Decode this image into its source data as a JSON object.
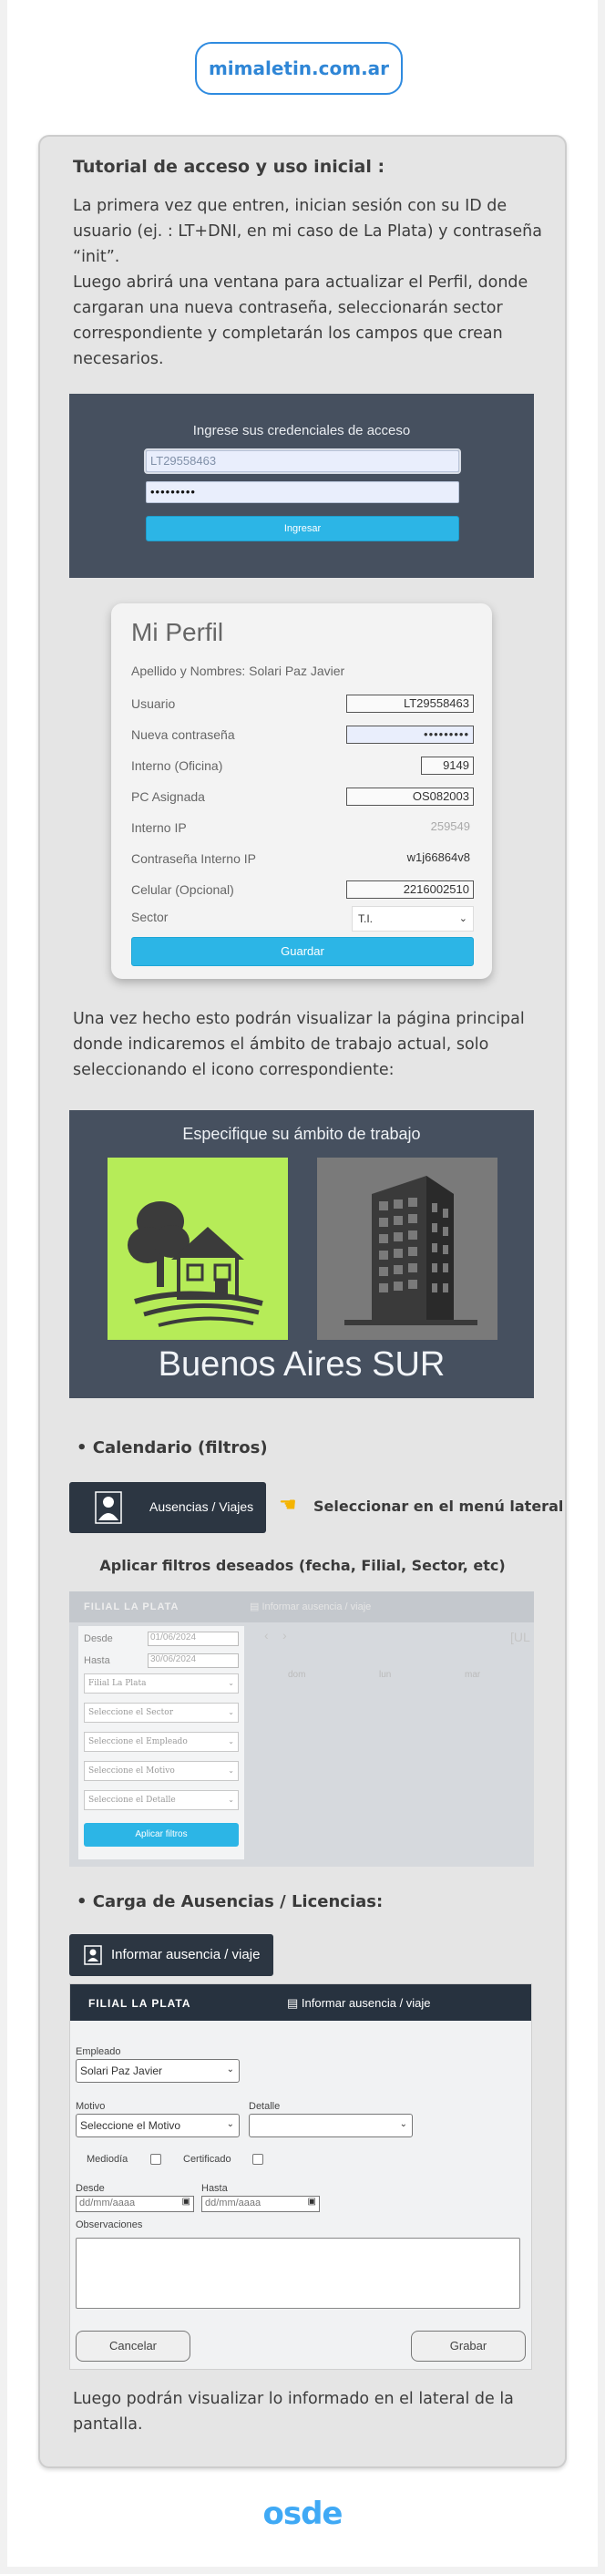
{
  "header": {
    "site": "mimaletin.com.ar"
  },
  "tutorial": {
    "title": "Tutorial de acceso y uso inicial :",
    "intro_lines": [
      "La primera vez que entren, inician sesión con su ID de",
      "usuario (ej. : LT+DNI, en mi caso de La Plata) y contraseña",
      "“init”.",
      "Luego abrirá una ventana para actualizar el Perfil, donde",
      "cargaran una nueva contraseña, seleccionarán sector",
      "correspondiente y completarán los campos que crean",
      "necesarios."
    ]
  },
  "login": {
    "title": "Ingrese sus credenciales de acceso",
    "user_value": "LT29558463",
    "password_value": "•••••••••",
    "button": "Ingresar"
  },
  "perfil": {
    "title": "Mi Perfil",
    "name_line": "Apellido y Nombres: Solari Paz Javier",
    "rows": [
      {
        "label": "Usuario",
        "value": "LT29558463"
      },
      {
        "label": "Nueva contraseña",
        "value": "•••••••••"
      },
      {
        "label": "Interno (Oficina)",
        "value": "9149"
      },
      {
        "label": "PC Asignada",
        "value": "OS082003"
      },
      {
        "label": "Interno IP",
        "value": "259549"
      },
      {
        "label": "Contraseña Interno IP",
        "value": "w1j66864v8"
      },
      {
        "label": "Celular (Opcional)",
        "value": "2216002510"
      }
    ],
    "sector_label": "Sector",
    "sector_value": "T.I.",
    "save_button": "Guardar"
  },
  "after_profile": {
    "lines": [
      "Una vez hecho esto podrán visualizar la página principal",
      "donde indicaremos el ámbito de trabajo actual, solo",
      "seleccionando el icono correspondiente:"
    ]
  },
  "ambito": {
    "title": "Especifique su ámbito de trabajo",
    "place": "Buenos Aires SUR"
  },
  "calendario": {
    "heading": "Calendario (filtros)",
    "menu_button": "Ausencias / Viajes",
    "select_note": "Seleccionar en el menú lateral",
    "filters_note": "Aplicar filtros deseados (fecha,  Filial, Sector, etc)",
    "filter_panel": {
      "brand": "FILIAL LA PLATA",
      "top_link": "Informar ausencia / viaje",
      "desde_label": "Desde",
      "desde_value": "01/06/2024",
      "hasta_label": "Hasta",
      "hasta_value": "30/06/2024",
      "selects": [
        "Filial La Plata",
        "Seleccione el Sector",
        "Seleccione el Empleado",
        "Seleccione el Motivo",
        "Seleccione el Detalle"
      ],
      "apply": "Aplicar filtros",
      "nav_prev": "‹",
      "nav_next": "›",
      "month_partial": "[UL",
      "weekdays": [
        "dom",
        "lun",
        "mar"
      ]
    }
  },
  "carga": {
    "heading": "Carga de Ausencias / Licencias:",
    "button": "Informar ausencia / viaje",
    "form": {
      "brand": "FILIAL LA PLATA",
      "top_link": "Informar ausencia / viaje",
      "empleado_label": "Empleado",
      "empleado_value": "Solari Paz Javier",
      "motivo_label": "Motivo",
      "motivo_value": "Seleccione el Motivo",
      "detalle_label": "Detalle",
      "mediodia_label": "Mediodía",
      "certificado_label": "Certificado",
      "desde_label": "Desde",
      "hasta_label": "Hasta",
      "date_placeholder": "dd/mm/aaaa",
      "observaciones_label": "Observaciones",
      "cancel": "Cancelar",
      "save": "Grabar"
    }
  },
  "closing": {
    "lines": [
      "Luego podrán visualizar lo informado en el lateral de la",
      "pantalla."
    ]
  },
  "footer": {
    "logo_text": "osde"
  },
  "colors": {
    "accent": "#2cb5e6",
    "dark_panel": "#46505f",
    "link_blue": "#2f86d6",
    "green_tile": "#b6ec58"
  }
}
